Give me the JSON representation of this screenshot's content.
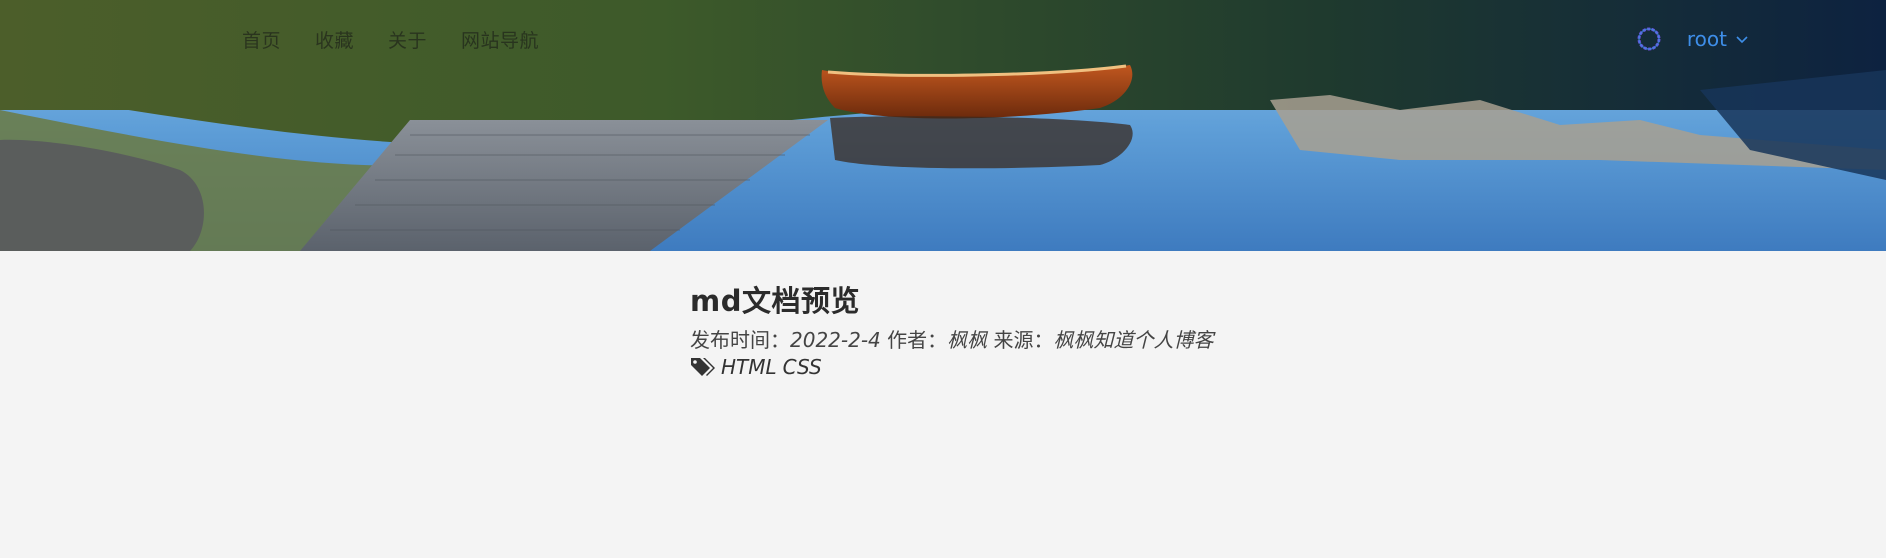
{
  "nav": {
    "items": [
      {
        "label": "首页"
      },
      {
        "label": "收藏"
      },
      {
        "label": "关于"
      },
      {
        "label": "网站导航"
      }
    ]
  },
  "user": {
    "name": "root",
    "accent": "#3e8ee8",
    "avatar_icon": "ring-icon",
    "menu_icon": "chevron-down-icon"
  },
  "article": {
    "title": "md文档预览",
    "publish_label": "发布时间：",
    "publish_date": "2022-2-4",
    "author_label": "作者：",
    "author": "枫枫",
    "source_label": "来源：",
    "source": "枫枫知道个人博客",
    "tag_icon": "tags-icon",
    "tags": [
      "HTML",
      "CSS"
    ]
  }
}
